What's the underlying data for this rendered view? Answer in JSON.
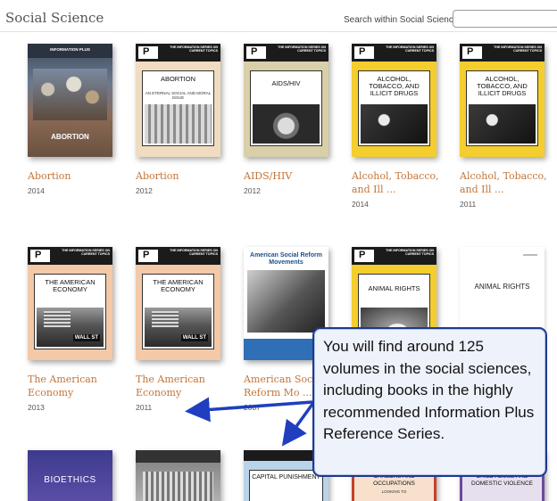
{
  "header": {
    "title": "Social Science",
    "search_label": "Search within Social Science",
    "search_value": ""
  },
  "books": [
    {
      "title": "Abortion",
      "year": "2014",
      "cover_caption": "ABORTION",
      "cover_series": "INFORMATION PLUS"
    },
    {
      "title": "Abortion",
      "year": "2012",
      "cover_title": "ABORTION",
      "cover_subtitle": "AN ETERNAL SOCIAL AND MORAL ISSUE",
      "cover_series": "THE INFORMATION SERIES ON CURRENT TOPICS"
    },
    {
      "title": "AIDS/HIV",
      "year": "2012",
      "cover_title": "AIDS/HIV",
      "cover_series": "THE INFORMATION SERIES ON CURRENT TOPICS"
    },
    {
      "title": "Alcohol, Tobacco, and Ill ...",
      "year": "2014",
      "cover_title": "ALCOHOL, TOBACCO, AND ILLICIT DRUGS",
      "cover_series": "THE INFORMATION SERIES ON CURRENT TOPICS"
    },
    {
      "title": "Alcohol, Tobacco, and Ill ...",
      "year": "2011",
      "cover_title": "ALCOHOL, TOBACCO, AND ILLICIT DRUGS",
      "cover_series": "THE INFORMATION SERIES ON CURRENT TOPICS"
    },
    {
      "title": "The American Economy",
      "year": "2013",
      "cover_title": "THE AMERICAN ECONOMY",
      "cover_sign": "WALL ST",
      "cover_series": "THE INFORMATION SERIES ON CURRENT TOPICS"
    },
    {
      "title": "The American Economy",
      "year": "2011",
      "cover_title": "THE AMERICAN ECONOMY",
      "cover_sign": "WALL ST",
      "cover_series": "THE INFORMATION SERIES ON CURRENT TOPICS"
    },
    {
      "title": "American Social Reform Mo ...",
      "year": "2007",
      "cover_title": "American Social Reform Movements"
    },
    {
      "title": "",
      "year": "",
      "cover_title": "ANIMAL RIGHTS",
      "cover_series": "THE INFORMATION SERIES ON CURRENT TOPICS"
    },
    {
      "title": "",
      "year": "",
      "cover_title": "ANIMAL RIGHTS"
    },
    {
      "cover_title": "BIOETHICS"
    },
    {
      "cover_title": ""
    },
    {
      "cover_title": "CAPITAL PUNISHMENT"
    },
    {
      "cover_title": "CAREERS AND OCCUPATIONS",
      "cover_subtitle": "LOOKING TO"
    },
    {
      "cover_title": "CHILD ABUSE AND DOMESTIC VIOLENCE"
    }
  ],
  "callout": {
    "text": "You will find around 125 volumes in the social sciences, including books in the highly recommended Information Plus Reference Series."
  },
  "colors": {
    "link": "#c27438",
    "callout_border": "#1e3a8f",
    "arrow": "#1f3fbf"
  }
}
